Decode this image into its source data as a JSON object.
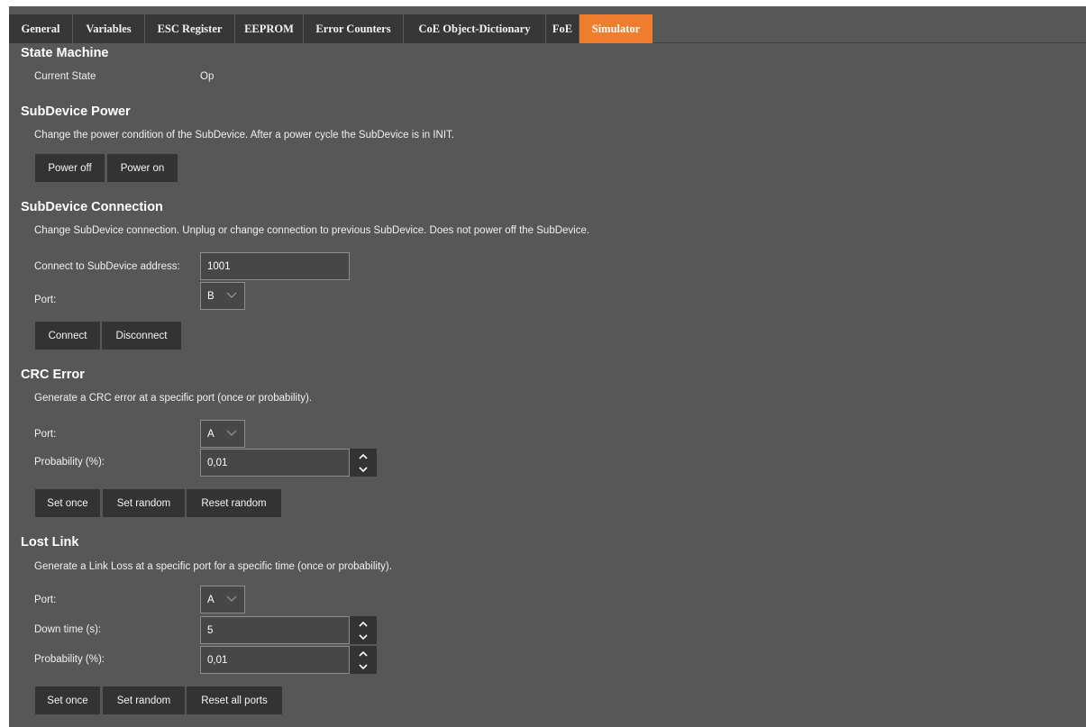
{
  "tabs": [
    {
      "label": "General"
    },
    {
      "label": "Variables"
    },
    {
      "label": "ESC Register"
    },
    {
      "label": "EEPROM"
    },
    {
      "label": "Error Counters"
    },
    {
      "label": "CoE Object-Dictionary"
    },
    {
      "label": "FoE"
    },
    {
      "label": "Simulator",
      "active": true
    }
  ],
  "state_machine": {
    "title": "State Machine",
    "current_state_label": "Current State",
    "current_state_value": "Op"
  },
  "power": {
    "title": "SubDevice Power",
    "description": "Change the power condition of the SubDevice. After a power cycle the SubDevice is in INIT.",
    "power_off_label": "Power off",
    "power_on_label": "Power on"
  },
  "connection": {
    "title": "SubDevice Connection",
    "description": "Change SubDevice connection. Unplug or change connection to previous SubDevice. Does not power off the SubDevice.",
    "address_label": "Connect to SubDevice address:",
    "address_value": "1001",
    "port_label": "Port:",
    "port_value": "B",
    "connect_label": "Connect",
    "disconnect_label": "Disconnect"
  },
  "crc": {
    "title": "CRC Error",
    "description": "Generate a CRC error at a specific port (once or probability).",
    "port_label": "Port:",
    "port_value": "A",
    "probability_label": "Probability (%):",
    "probability_value": "0,01",
    "set_once_label": "Set once",
    "set_random_label": "Set random",
    "reset_random_label": "Reset random"
  },
  "lost_link": {
    "title": "Lost Link",
    "description": "Generate a Link Loss at a specific port for a specific time (once or probability).",
    "port_label": "Port:",
    "port_value": "A",
    "down_time_label": "Down time (s):",
    "down_time_value": "5",
    "probability_label": "Probability (%):",
    "probability_value": "0,01",
    "set_once_label": "Set once",
    "set_random_label": "Set random",
    "reset_all_label": "Reset all ports"
  },
  "colors": {
    "background": "#575757",
    "tab": "#373737",
    "active_tab": "#ee7d2d",
    "button": "#333333",
    "input": "#474747"
  }
}
